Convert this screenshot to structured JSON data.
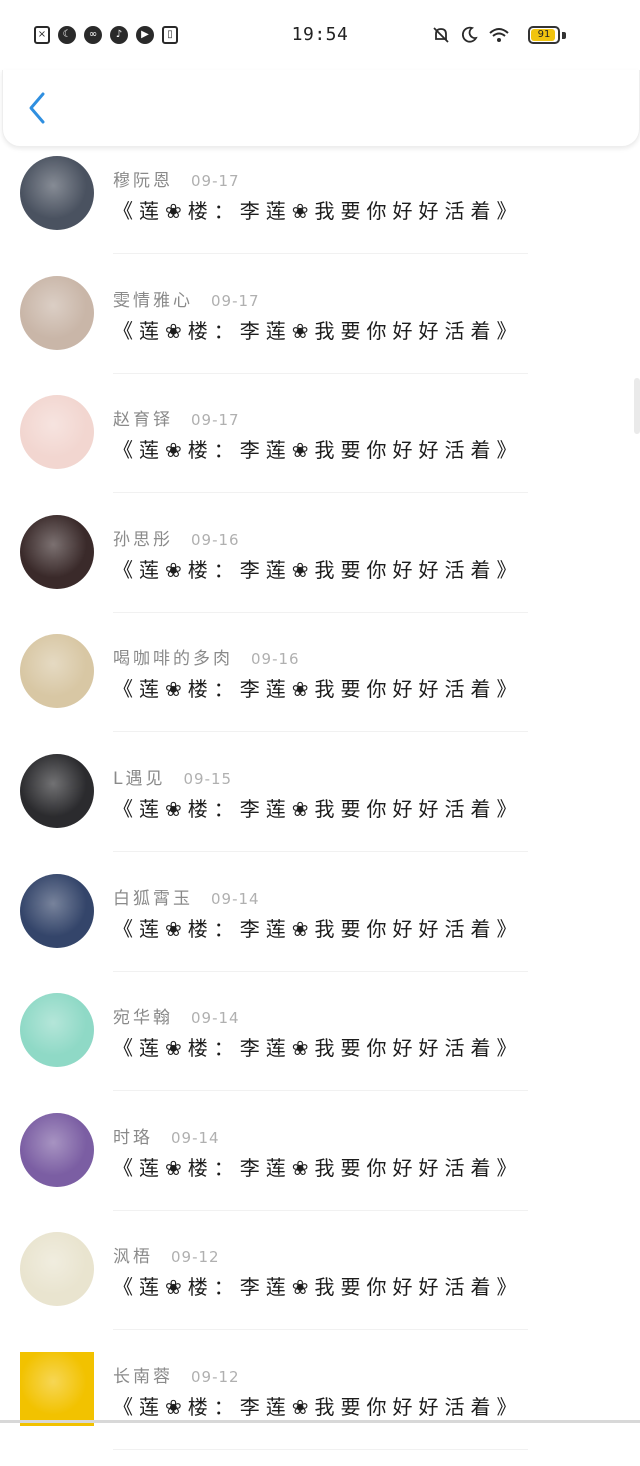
{
  "status": {
    "time": "19:54",
    "battery": "91",
    "battery_level": 0.91,
    "left_icons": [
      "sim-off-icon",
      "moon-icon",
      "app-icon",
      "music-icon",
      "play-icon",
      "book-icon"
    ],
    "right_icons": [
      "bell-off-icon",
      "moon-icon",
      "wifi-icon",
      "battery-icon"
    ]
  },
  "header": {
    "back_icon": "chevron-left-icon",
    "accent": "#2f8fe0"
  },
  "messages": [
    {
      "name": "穆阮恩",
      "date": "09-17",
      "text": "《莲❀楼：李莲❀我要你好好活着》",
      "avatar_color": "#4a5260"
    },
    {
      "name": "雯情雅心",
      "date": "09-17",
      "text": "《莲❀楼：李莲❀我要你好好活着》",
      "avatar_color": "#c9b6a8"
    },
    {
      "name": "赵育铎",
      "date": "09-17",
      "text": "《莲❀楼：李莲❀我要你好好活着》",
      "avatar_color": "#f2d6d0"
    },
    {
      "name": "孙思彤",
      "date": "09-16",
      "text": "《莲❀楼：李莲❀我要你好好活着》",
      "avatar_color": "#3a2a2a"
    },
    {
      "name": "喝咖啡的多肉",
      "date": "09-16",
      "text": "《莲❀楼：李莲❀我要你好好活着》",
      "avatar_color": "#d8c7a4"
    },
    {
      "name": "L遇见",
      "date": "09-15",
      "text": "《莲❀楼：李莲❀我要你好好活着》",
      "avatar_color": "#2b2b2e"
    },
    {
      "name": "白狐霄玉",
      "date": "09-14",
      "text": "《莲❀楼：李莲❀我要你好好活着》",
      "avatar_color": "#34456a"
    },
    {
      "name": "宛华翰",
      "date": "09-14",
      "text": "《莲❀楼：李莲❀我要你好好活着》",
      "avatar_color": "#8fd9c6"
    },
    {
      "name": "时珞",
      "date": "09-14",
      "text": "《莲❀楼：李莲❀我要你好好活着》",
      "avatar_color": "#7b5ea3"
    },
    {
      "name": "沨梧",
      "date": "09-12",
      "text": "《莲❀楼：李莲❀我要你好好活着》",
      "avatar_color": "#e9e4cf"
    },
    {
      "name": "长南蓉",
      "date": "09-12",
      "text": "《莲❀楼：李莲❀我要你好好活着》",
      "avatar_color": "#f2c200"
    }
  ]
}
